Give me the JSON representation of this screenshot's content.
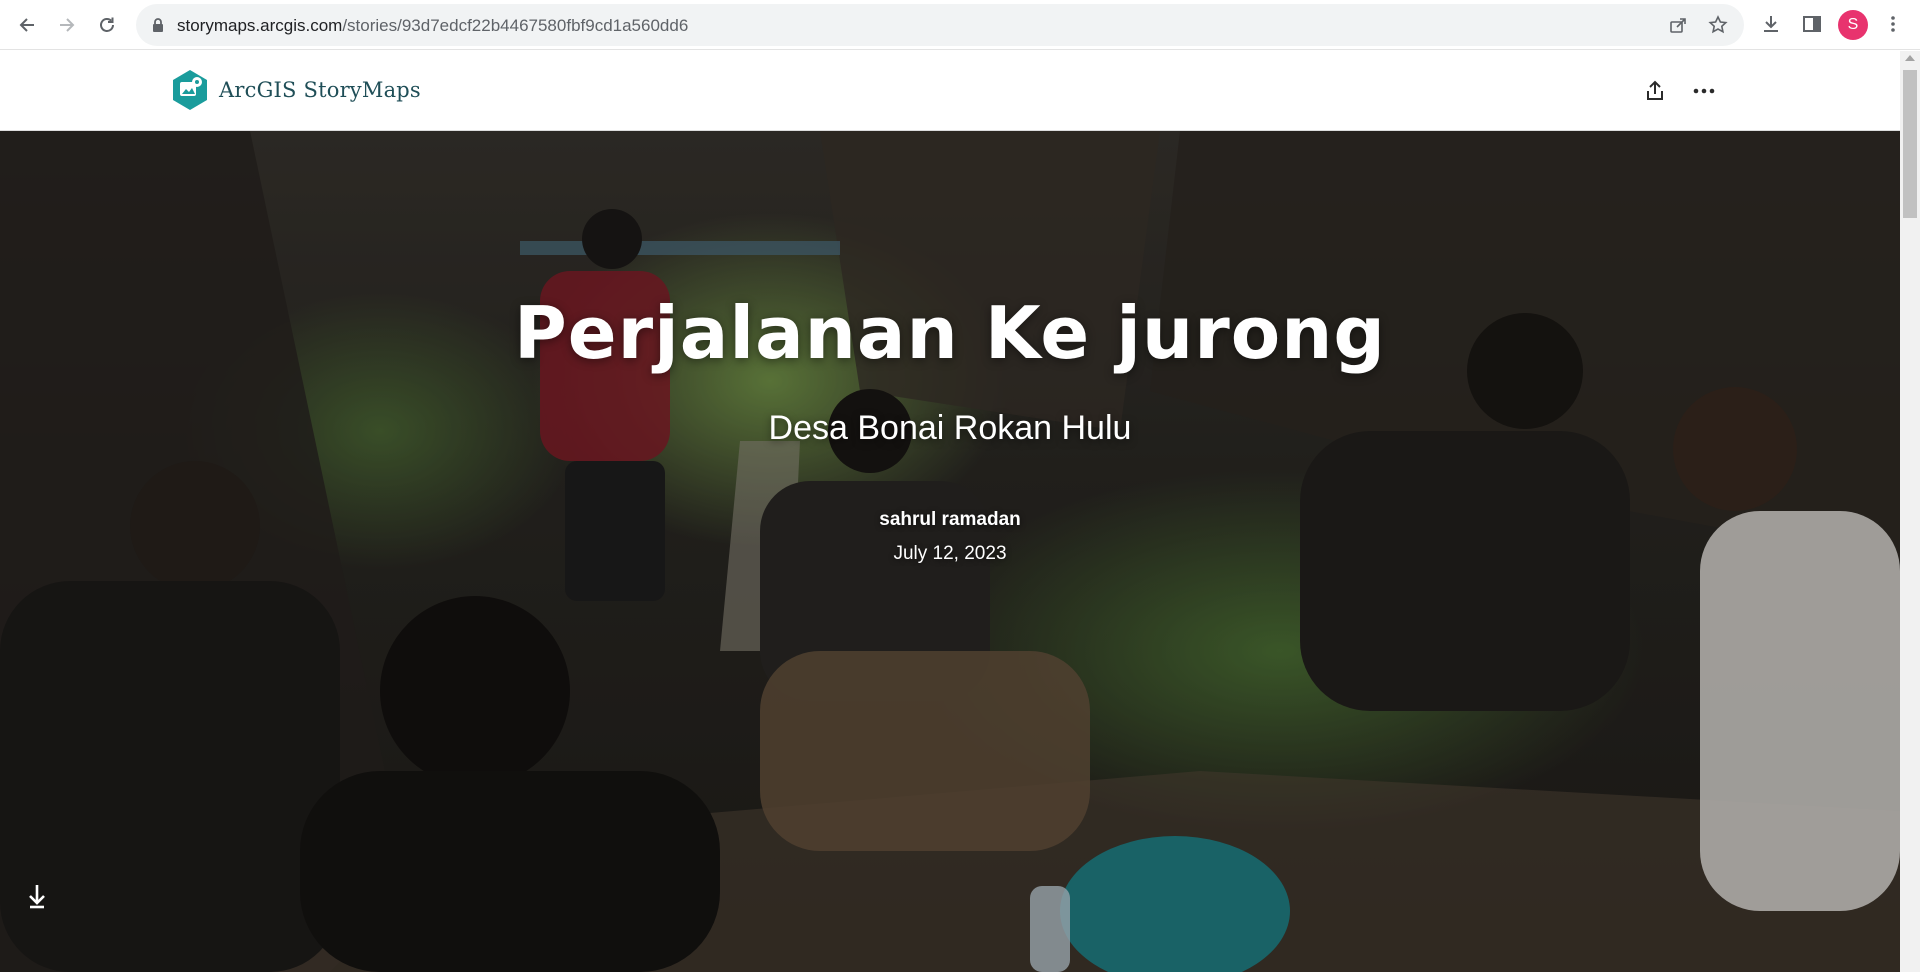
{
  "browser": {
    "url_domain": "storymaps.arcgis.com",
    "url_path": "/stories/93d7edcf22b4467580fbf9cd1a560dd6",
    "profile_initial": "S",
    "profile_color": "#e8336e",
    "icons": [
      "back-icon",
      "forward-icon",
      "reload-icon",
      "lock-icon",
      "share-icon",
      "bookmark-star-icon",
      "download-icon",
      "side-panel-icon",
      "menu-kebab-icon"
    ]
  },
  "header": {
    "brand_name": "ArcGIS StoryMaps",
    "brand_color": "#1f8a8a",
    "icons": [
      "share-icon",
      "more-options-icon"
    ]
  },
  "hero": {
    "title": "Perjalanan Ke jurong",
    "subtitle": "Desa Bonai Rokan Hulu",
    "author": "sahrul ramadan",
    "date": "July 12, 2023",
    "scroll_icon": "arrow-down-icon"
  }
}
